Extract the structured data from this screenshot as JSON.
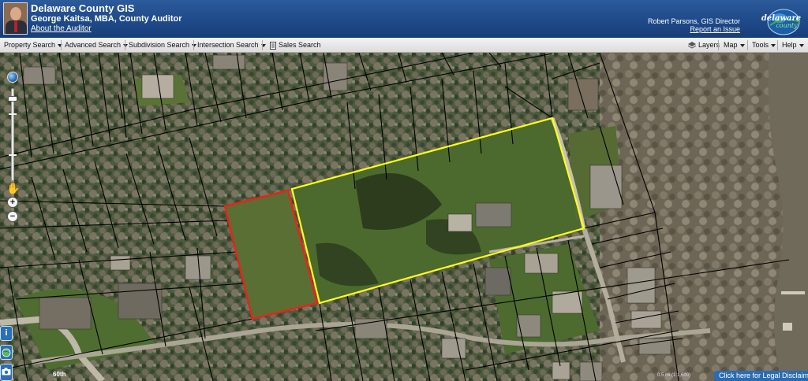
{
  "header": {
    "title": "Delaware County GIS",
    "subtitle": "George Kaitsa, MBA, County Auditor",
    "about_link": "About the Auditor",
    "director": "Robert Parsons, GIS Director",
    "report_link": "Report an Issue",
    "logo_text_top": "delaware",
    "logo_text_bottom": "county"
  },
  "toolbar": {
    "items": [
      {
        "label": "Property Search",
        "dropdown": true
      },
      {
        "label": "Advanced Search",
        "dropdown": true
      },
      {
        "label": "Subdivision Search",
        "dropdown": true
      },
      {
        "label": "Intersection Search",
        "dropdown": true
      },
      {
        "label": "Sales Search",
        "dropdown": false,
        "icon": "document-icon"
      }
    ],
    "right_items": [
      {
        "label": "Layers",
        "dropdown": false,
        "icon": "layers-icon"
      },
      {
        "label": "Map",
        "dropdown": true
      },
      {
        "label": "Tools",
        "dropdown": true
      },
      {
        "label": "Help",
        "dropdown": true
      }
    ]
  },
  "map": {
    "road_label": "60th",
    "scale_text": "0.5 mi (1:1,600)",
    "disclaimer": "Click here for Legal Disclaimer",
    "colors": {
      "selected_parcel": "#ffff1a",
      "highlight_parcel": "#e8231a",
      "parcel_lines": "#000000",
      "brand_blue": "#1f4a8a"
    }
  },
  "map_tools": {
    "info_label": "i",
    "zoom_in_label": "+",
    "zoom_out_label": "−"
  }
}
